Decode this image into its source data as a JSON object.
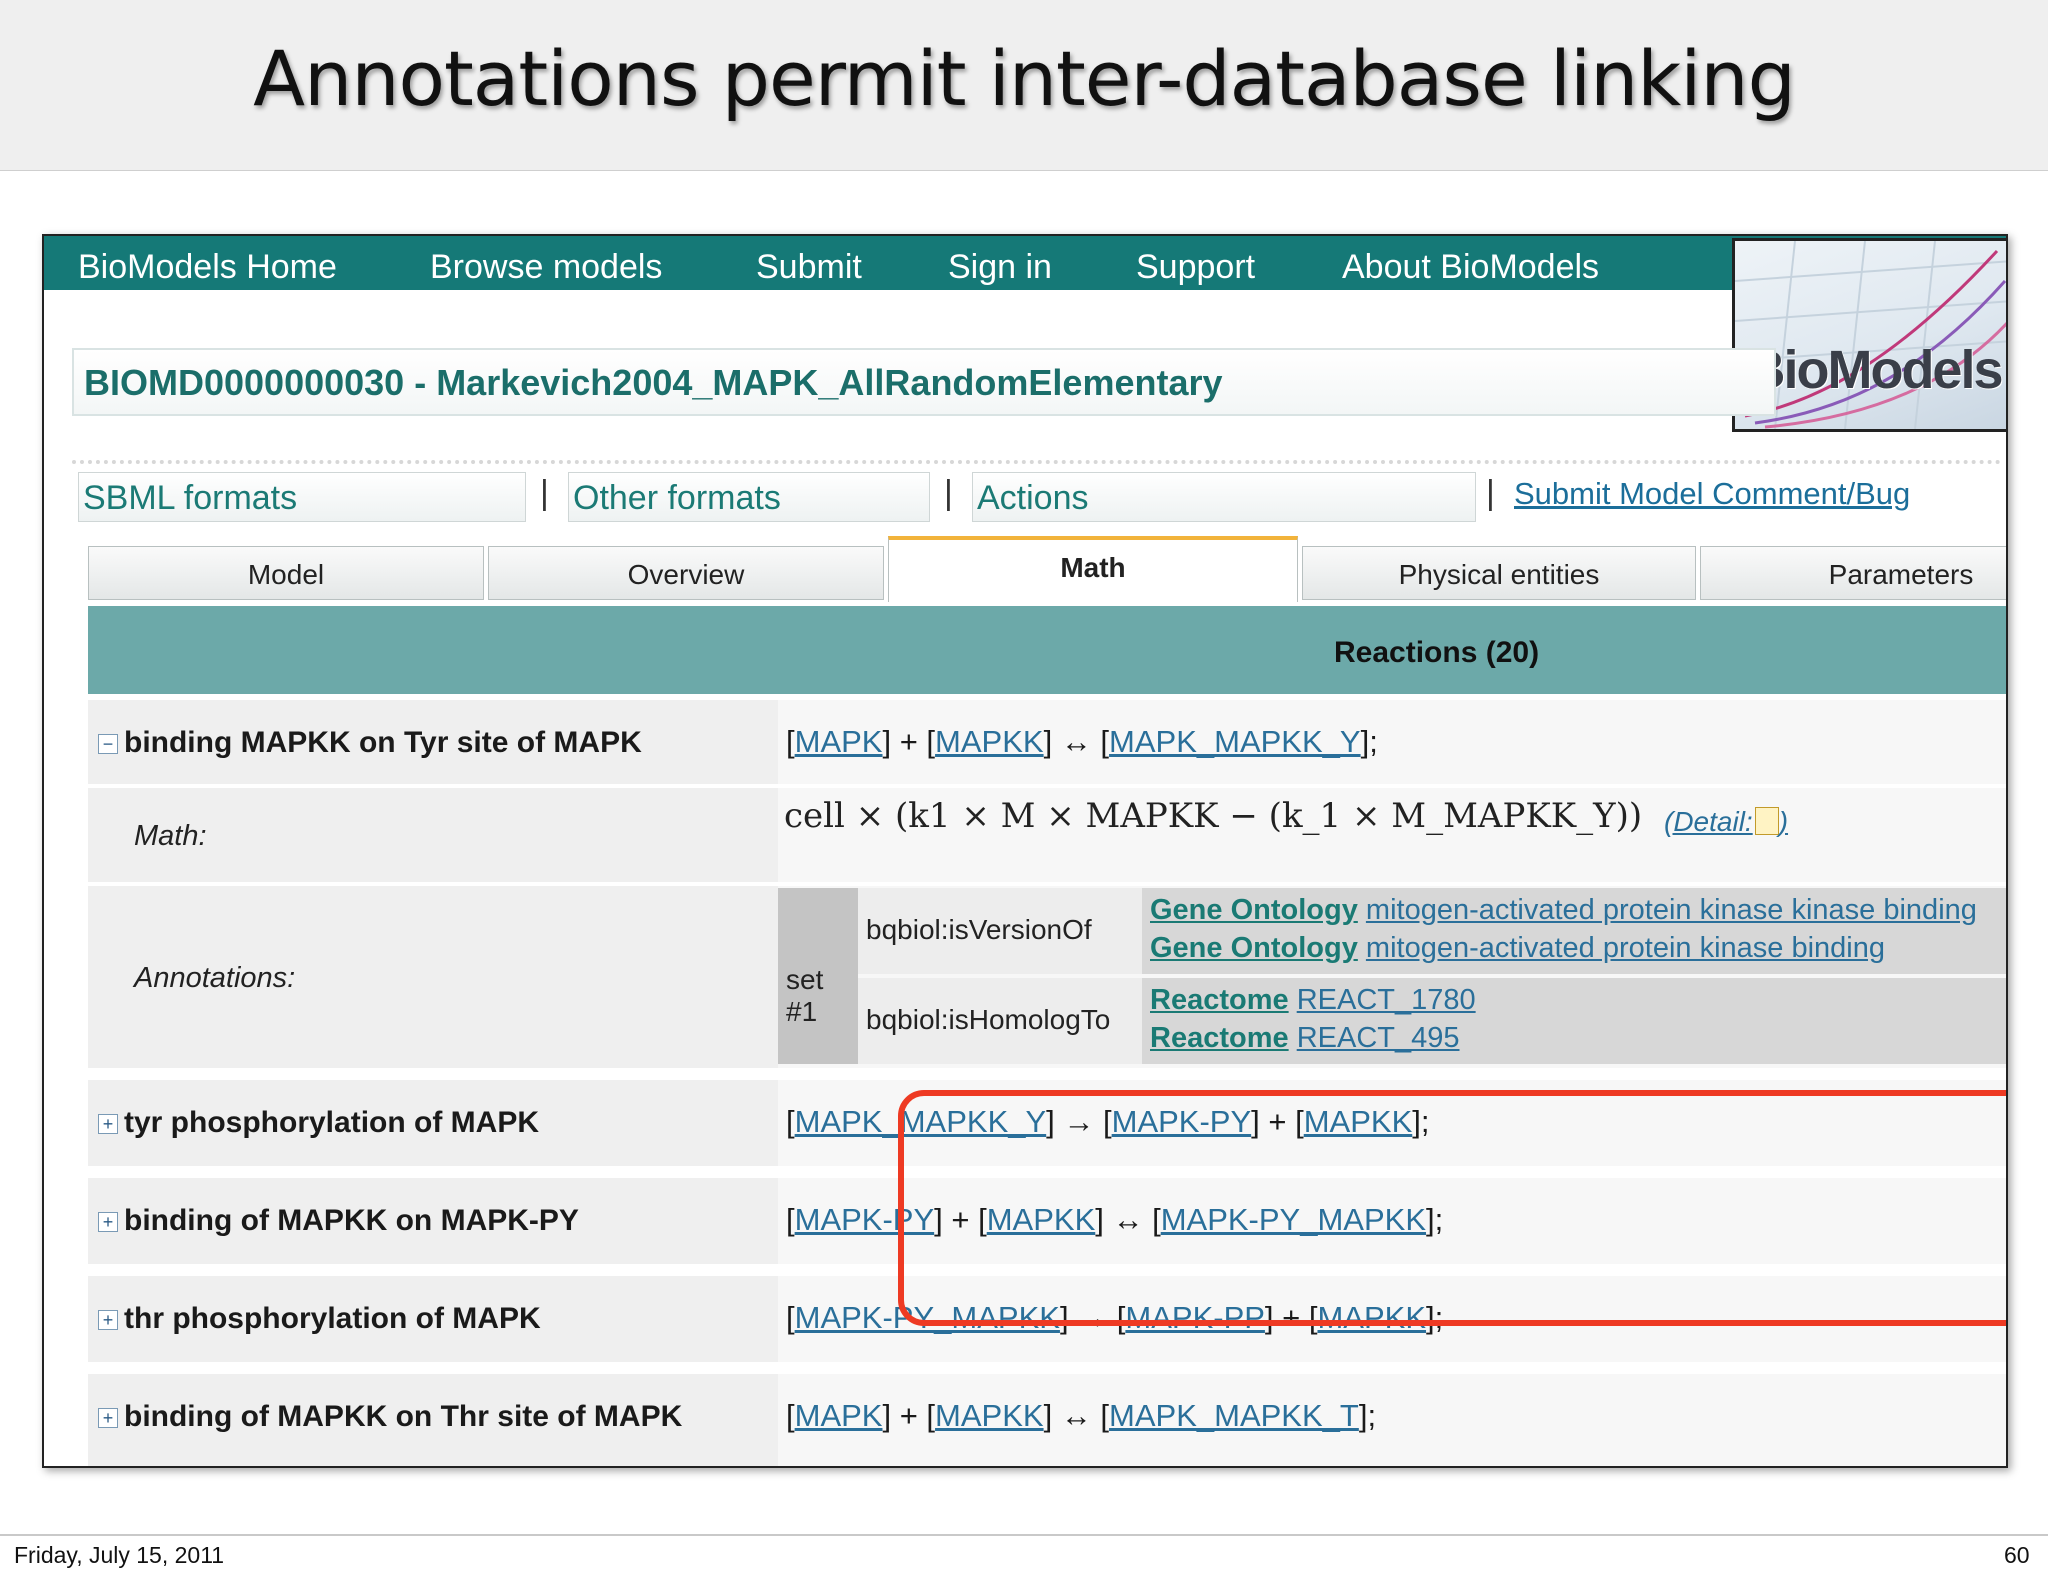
{
  "slide": {
    "title": "Annotations permit inter-database linking",
    "footer_date": "Friday, July 15, 2011",
    "page_number": "60"
  },
  "nav": {
    "items": [
      "BioModels Home",
      "Browse models",
      "Submit",
      "Sign in",
      "Support",
      "About BioModels"
    ],
    "logo_text": "BioModels"
  },
  "model": {
    "title": "BIOMD0000000030 - Markevich2004_MAPK_AllRandomElementary"
  },
  "toolbar": {
    "sbml_formats": "SBML formats",
    "other_formats": "Other formats",
    "actions": "Actions",
    "separator": "|",
    "submit_comment": "Submit Model Comment/Bug"
  },
  "tabs": [
    {
      "label": "Model",
      "active": false
    },
    {
      "label": "Overview",
      "active": false
    },
    {
      "label": "Math",
      "active": true
    },
    {
      "label": "Physical entities",
      "active": false
    },
    {
      "label": "Parameters",
      "active": false
    }
  ],
  "reactions_header": "Reactions (20)",
  "reactions": [
    {
      "name": "binding MAPKK on Tyr site of MAPK",
      "toggle": "−",
      "equation": [
        {
          "t": "["
        },
        {
          "link": "MAPK"
        },
        {
          "t": "] + ["
        },
        {
          "link": "MAPKK"
        },
        {
          "t": "] ↔ ["
        },
        {
          "link": "MAPK_MAPKK_Y"
        },
        {
          "t": "];"
        }
      ],
      "math_label": "Math:",
      "math": "cell × (k1 × M × MAPKK − (k_1 × M_MAPKK_Y))",
      "detail": "(Detail:",
      "annotations_label": "Annotations:",
      "annotation_set": "set #1",
      "annotations": [
        {
          "qualifier": "bqbiol:isVersionOf",
          "resources": [
            {
              "db": "Gene Ontology",
              "term": "mitogen-activated protein kinase kinase binding"
            },
            {
              "db": "Gene Ontology",
              "term": "mitogen-activated protein kinase binding"
            }
          ]
        },
        {
          "qualifier": "bqbiol:isHomologTo",
          "resources": [
            {
              "db": "Reactome",
              "term": "REACT_1780"
            },
            {
              "db": "Reactome",
              "term": "REACT_495"
            }
          ]
        }
      ]
    },
    {
      "name": "tyr phosphorylation of MAPK",
      "toggle": "+",
      "equation": [
        {
          "t": "["
        },
        {
          "link": "MAPK_MAPKK_Y"
        },
        {
          "t": "] → ["
        },
        {
          "link": "MAPK-PY"
        },
        {
          "t": "] + ["
        },
        {
          "link": "MAPKK"
        },
        {
          "t": "];"
        }
      ]
    },
    {
      "name": "binding of MAPKK on MAPK-PY",
      "toggle": "+",
      "equation": [
        {
          "t": "["
        },
        {
          "link": "MAPK-PY"
        },
        {
          "t": "] + ["
        },
        {
          "link": "MAPKK"
        },
        {
          "t": "] ↔ ["
        },
        {
          "link": "MAPK-PY_MAPKK"
        },
        {
          "t": "];"
        }
      ]
    },
    {
      "name": "thr phosphorylation of MAPK",
      "toggle": "+",
      "equation": [
        {
          "t": "["
        },
        {
          "link": "MAPK-PY_MAPKK"
        },
        {
          "t": "] → ["
        },
        {
          "link": "MAPK-PP"
        },
        {
          "t": "] + ["
        },
        {
          "link": "MAPKK"
        },
        {
          "t": "];"
        }
      ]
    },
    {
      "name": "binding of MAPKK on Thr site of MAPK",
      "toggle": "+",
      "equation": [
        {
          "t": "["
        },
        {
          "link": "MAPK"
        },
        {
          "t": "] + ["
        },
        {
          "link": "MAPKK"
        },
        {
          "t": "] ↔ ["
        },
        {
          "link": "MAPK_MAPKK_T"
        },
        {
          "t": "];"
        }
      ]
    }
  ],
  "colors": {
    "nav_bg": "#157977",
    "reactions_header_bg": "#6ca9a9",
    "active_tab_accent": "#f2b33a",
    "highlight": "#ee3a23",
    "link": "#2a6f9a"
  }
}
